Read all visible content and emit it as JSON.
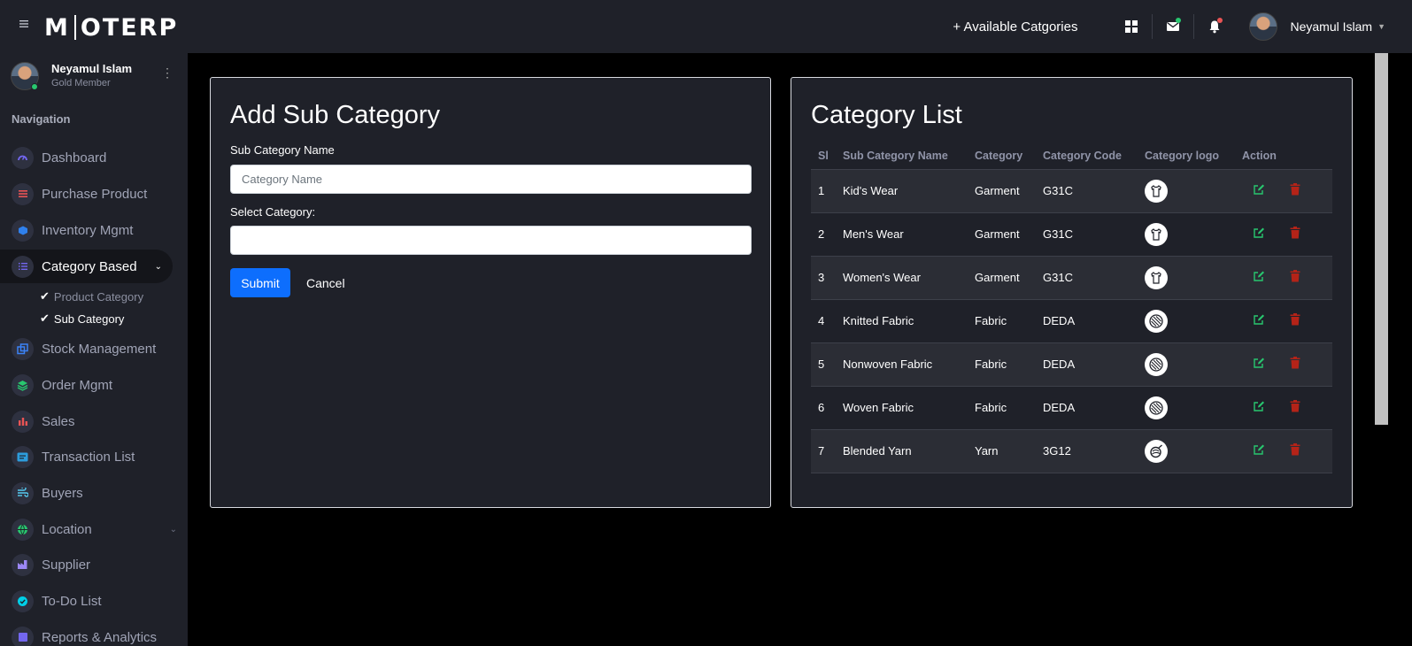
{
  "topbar": {
    "logo": "MOTERP",
    "logo_prefix": "M",
    "logo_suffix": "OTERP",
    "available_categories": "+ Available Catgories",
    "user_name": "Neyamul Islam"
  },
  "sidebar": {
    "profile_name": "Neyamul Islam",
    "profile_role": "Gold Member",
    "nav_title": "Navigation",
    "items": [
      {
        "label": "Dashboard",
        "icon": "gauge-icon",
        "color": "#7367f0"
      },
      {
        "label": "Purchase Product",
        "icon": "list-icon",
        "color": "#ea5455"
      },
      {
        "label": "Inventory Mgmt",
        "icon": "box-icon",
        "color": "#2f80ed"
      },
      {
        "label": "Category Based",
        "icon": "list-check-icon",
        "color": "#7367f0"
      },
      {
        "label": "Stock Management",
        "icon": "copy-icon",
        "color": "#3b82f6"
      },
      {
        "label": "Order Mgmt",
        "icon": "layers-icon",
        "color": "#28c76f"
      },
      {
        "label": "Sales",
        "icon": "bar-chart-icon",
        "color": "#ea5455"
      },
      {
        "label": "Transaction List",
        "icon": "id-card-icon",
        "color": "#2d9cdb"
      },
      {
        "label": "Buyers",
        "icon": "wind-icon",
        "color": "#56ccf2"
      },
      {
        "label": "Location",
        "icon": "globe-icon",
        "color": "#28c76f"
      },
      {
        "label": "Supplier",
        "icon": "industry-icon",
        "color": "#9b87f5"
      },
      {
        "label": "To-Do List",
        "icon": "check-circle-icon",
        "color": "#00cfe8"
      },
      {
        "label": "Reports & Analytics",
        "icon": "report-icon",
        "color": "#7367f0"
      }
    ],
    "sub_items": [
      {
        "label": "Product Category"
      },
      {
        "label": "Sub Category"
      }
    ]
  },
  "form": {
    "title": "Add Sub Category",
    "name_label": "Sub Category Name",
    "name_placeholder": "Category Name",
    "select_label": "Select Category:",
    "select_value": "",
    "submit": "Submit",
    "cancel": "Cancel"
  },
  "list": {
    "title": "Category List",
    "columns": [
      "Sl",
      "Sub Category Name",
      "Category",
      "Category Code",
      "Category logo",
      "Action"
    ],
    "rows": [
      {
        "sl": "1",
        "name": "Kid's Wear",
        "category": "Garment",
        "code": "G31C",
        "logo": "shirt-icon"
      },
      {
        "sl": "2",
        "name": "Men's Wear",
        "category": "Garment",
        "code": "G31C",
        "logo": "shirt-icon"
      },
      {
        "sl": "3",
        "name": "Women's Wear",
        "category": "Garment",
        "code": "G31C",
        "logo": "shirt-icon"
      },
      {
        "sl": "4",
        "name": "Knitted Fabric",
        "category": "Fabric",
        "code": "DEDA",
        "logo": "fabric-icon"
      },
      {
        "sl": "5",
        "name": "Nonwoven Fabric",
        "category": "Fabric",
        "code": "DEDA",
        "logo": "fabric-icon"
      },
      {
        "sl": "6",
        "name": "Woven Fabric",
        "category": "Fabric",
        "code": "DEDA",
        "logo": "fabric-icon"
      },
      {
        "sl": "7",
        "name": "Blended Yarn",
        "category": "Yarn",
        "code": "3G12",
        "logo": "yarn-icon"
      }
    ]
  },
  "colors": {
    "accent": "#0d6efd",
    "edit": "#28c76f",
    "delete": "#b42318",
    "panel_bg": "#1f2129"
  }
}
